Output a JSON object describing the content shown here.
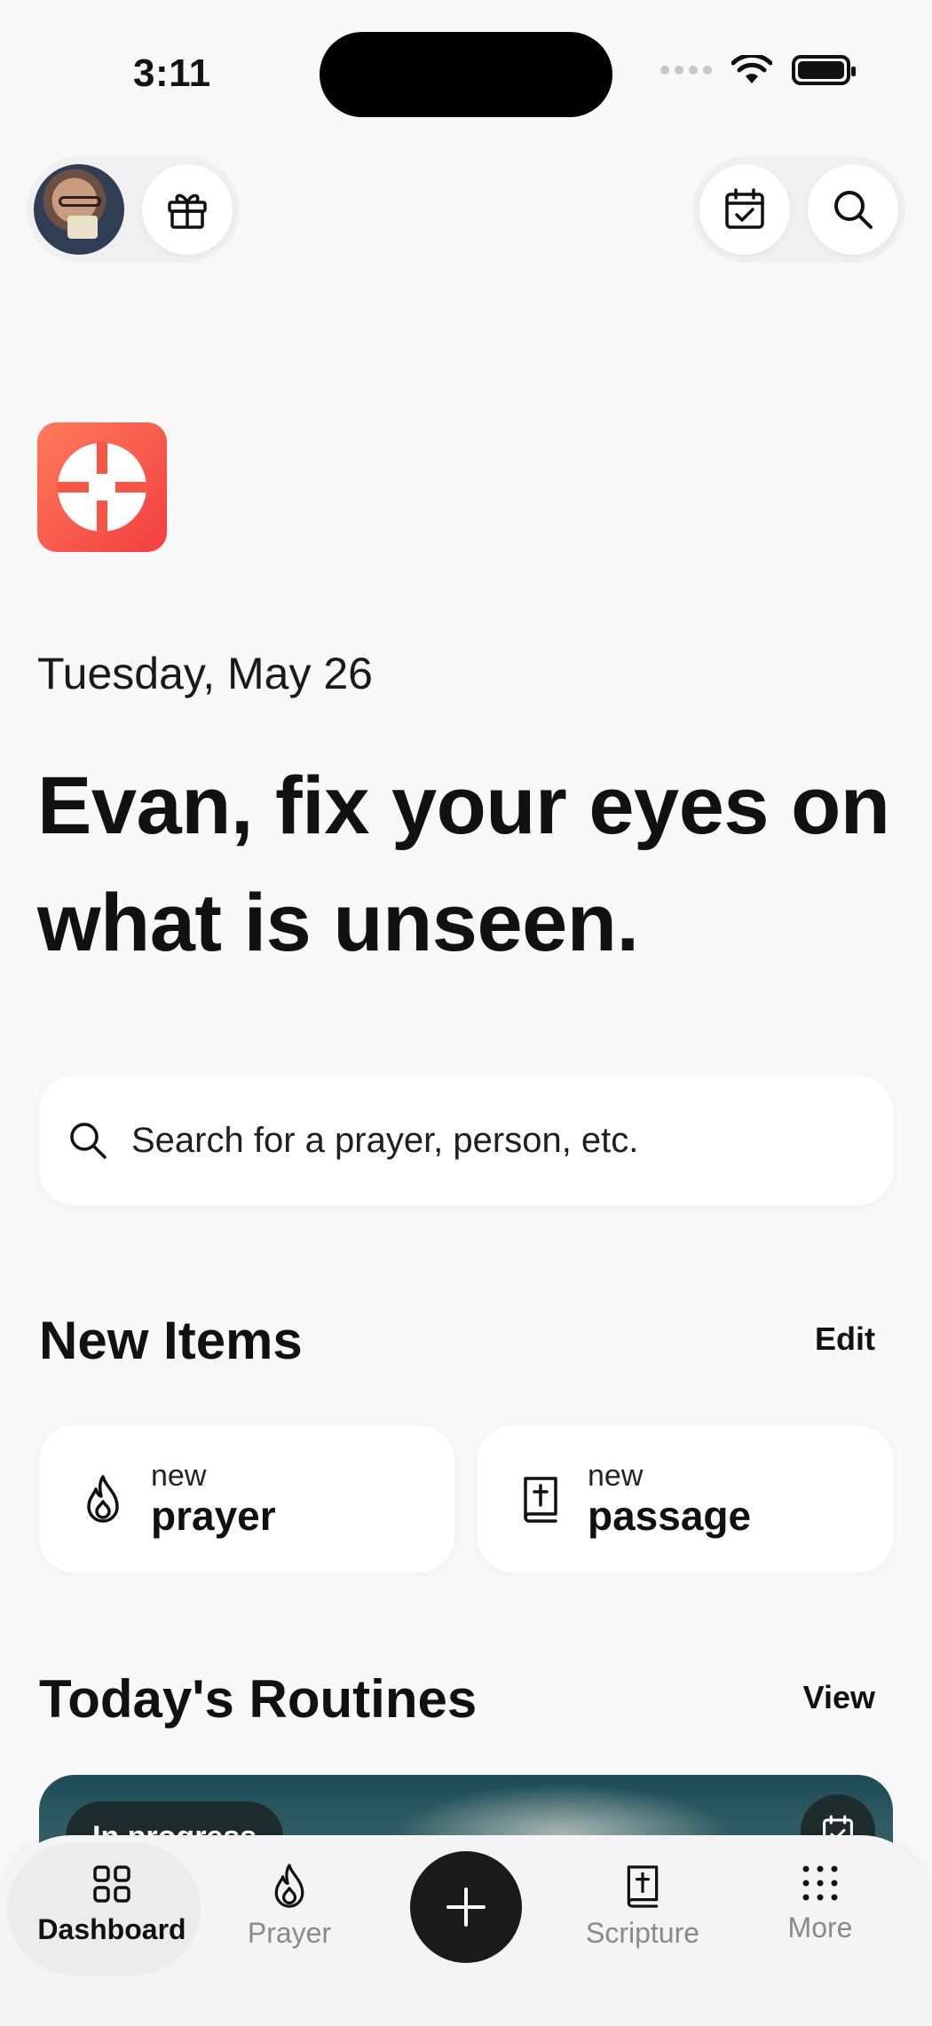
{
  "status_bar": {
    "time": "3:11"
  },
  "header": {
    "gift_icon": "gift-icon",
    "calendar_icon": "calendar-check-icon",
    "search_icon": "search-icon"
  },
  "hero": {
    "date": "Tuesday, May 26",
    "headline": "Evan, fix your eyes on what is unseen."
  },
  "search": {
    "placeholder": "Search for a prayer, person, etc."
  },
  "new_items": {
    "title": "New Items",
    "edit_label": "Edit",
    "cards": [
      {
        "small": "new",
        "big": "prayer",
        "icon": "flame-icon"
      },
      {
        "small": "new",
        "big": "passage",
        "icon": "bible-icon"
      }
    ]
  },
  "routines": {
    "title": "Today's Routines",
    "view_label": "View",
    "status": "In progress"
  },
  "tab_bar": {
    "tabs": [
      {
        "label": "Dashboard",
        "icon": "grid-icon",
        "active": true
      },
      {
        "label": "Prayer",
        "icon": "flame-icon"
      },
      {
        "label": "Scripture",
        "icon": "bible-icon"
      },
      {
        "label": "More",
        "icon": "dots-grid-icon"
      }
    ],
    "add_icon": "plus-icon"
  },
  "colors": {
    "background": "#f8f8f8",
    "logo_gradient_start": "#ff7b5c",
    "logo_gradient_end": "#f23e3e",
    "accent_dark": "#1a1a1a"
  }
}
